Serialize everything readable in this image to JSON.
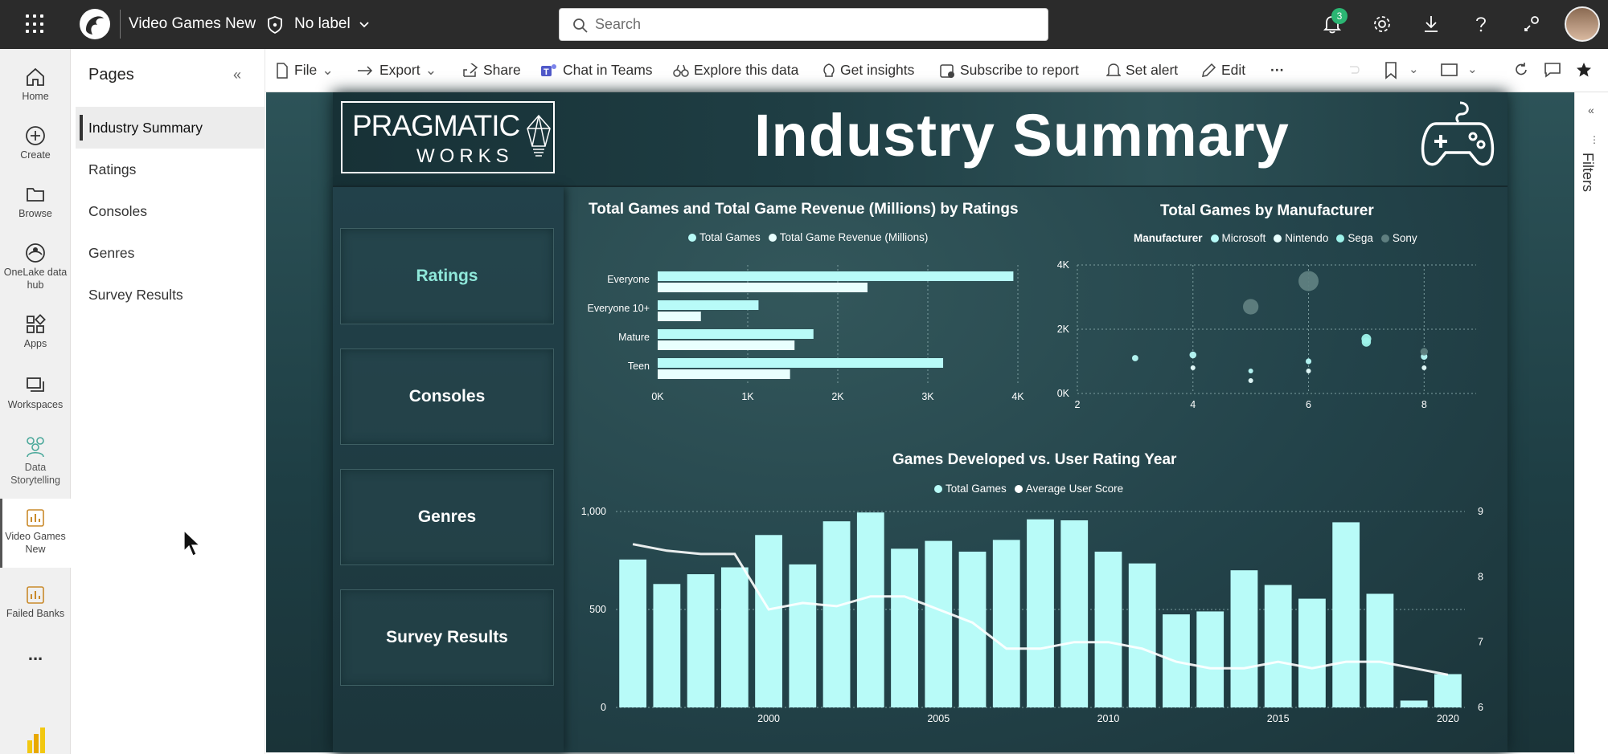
{
  "topbar": {
    "workspace_title": "Video Games New",
    "sensitivity_label": "No label",
    "search_placeholder": "Search",
    "notification_count": "3",
    "icons": [
      "app-launcher-icon",
      "notifications-icon",
      "settings-icon",
      "download-icon",
      "help-icon",
      "share-people-icon"
    ]
  },
  "leftnav": {
    "items": [
      {
        "label": "Home",
        "icon": "home-icon"
      },
      {
        "label": "Create",
        "icon": "plus-circle-icon"
      },
      {
        "label": "Browse",
        "icon": "folder-icon"
      },
      {
        "label": "OneLake data hub",
        "icon": "onelake-icon"
      },
      {
        "label": "Apps",
        "icon": "apps-icon"
      },
      {
        "label": "Workspaces",
        "icon": "workspaces-icon"
      },
      {
        "label": "Data Storytelling",
        "icon": "storytelling-icon"
      },
      {
        "label": "Video Games New",
        "icon": "report-icon"
      },
      {
        "label": "Failed Banks",
        "icon": "report-icon"
      },
      {
        "label": "...",
        "icon": "more-icon"
      }
    ]
  },
  "pages": {
    "title": "Pages",
    "items": [
      "Industry Summary",
      "Ratings",
      "Consoles",
      "Genres",
      "Survey Results"
    ],
    "selected": "Industry Summary"
  },
  "actionbar": {
    "file": "File",
    "export": "Export",
    "share": "Share",
    "chat_in_teams": "Chat in Teams",
    "explore": "Explore this data",
    "insights": "Get insights",
    "subscribe": "Subscribe to report",
    "set_alert": "Set alert",
    "edit": "Edit",
    "more": "···"
  },
  "report": {
    "logo_line1": "PRAGMATIC",
    "logo_line2": "WORKS",
    "title": "Industry Summary",
    "nav_buttons": [
      "Ratings",
      "Consoles",
      "Genres",
      "Survey Results"
    ],
    "colors": {
      "accent": "#b8fbf8",
      "sony": "#5f7f80",
      "active_nav": "#8fe8da"
    }
  },
  "filters_label": "Filters",
  "chart_data": [
    {
      "type": "bar",
      "orientation": "horizontal",
      "title": "Total Games and Total Game Revenue (Millions) by Ratings",
      "categories": [
        "Everyone",
        "Everyone 10+",
        "Mature",
        "Teen"
      ],
      "series": [
        {
          "name": "Total Games",
          "values": [
            3950,
            1120,
            1730,
            3170
          ]
        },
        {
          "name": "Total Game Revenue (Millions)",
          "values": [
            2330,
            480,
            1520,
            1470
          ]
        }
      ],
      "x_ticks": [
        "0K",
        "1K",
        "2K",
        "3K",
        "4K"
      ],
      "xlim": [
        0,
        4000
      ]
    },
    {
      "type": "scatter",
      "title": "Total Games by Manufacturer",
      "legend_title": "Manufacturer",
      "series": [
        {
          "name": "Microsoft",
          "points": [
            [
              3,
              1100
            ],
            [
              4,
              1200
            ],
            [
              5,
              700
            ],
            [
              6,
              1000
            ],
            [
              8,
              1150
            ]
          ]
        },
        {
          "name": "Nintendo",
          "points": [
            [
              4,
              800
            ],
            [
              5,
              400
            ],
            [
              6,
              700
            ],
            [
              8,
              800
            ]
          ]
        },
        {
          "name": "Sega",
          "points": [
            [
              7,
              1600
            ],
            [
              7,
              1700
            ]
          ]
        },
        {
          "name": "Sony",
          "points": [
            [
              5,
              2700
            ],
            [
              6,
              3500
            ],
            [
              8,
              1300
            ]
          ]
        }
      ],
      "x_ticks": [
        "2",
        "4",
        "6",
        "8"
      ],
      "y_ticks": [
        "0K",
        "2K",
        "4K"
      ],
      "xlim": [
        2,
        8.9
      ],
      "ylim": [
        0,
        4000
      ]
    },
    {
      "type": "bar",
      "title": "Games Developed vs. User Rating Year",
      "categories": [
        1996,
        1997,
        1998,
        1999,
        2000,
        2001,
        2002,
        2003,
        2004,
        2005,
        2006,
        2007,
        2008,
        2009,
        2010,
        2011,
        2012,
        2013,
        2014,
        2015,
        2016,
        2017,
        2018,
        2019,
        2020
      ],
      "series": [
        {
          "name": "Total Games",
          "values": [
            755,
            630,
            680,
            715,
            880,
            730,
            950,
            995,
            810,
            850,
            795,
            855,
            960,
            955,
            795,
            735,
            475,
            490,
            700,
            625,
            555,
            945,
            580,
            35,
            170
          ]
        },
        {
          "name": "Average User Score",
          "axis": "right",
          "values": [
            8.5,
            8.4,
            8.35,
            8.35,
            7.5,
            7.6,
            7.55,
            7.7,
            7.7,
            7.5,
            7.3,
            6.9,
            6.9,
            7.0,
            7.0,
            6.9,
            6.7,
            6.6,
            6.6,
            6.7,
            6.6,
            6.7,
            6.7,
            6.6,
            6.5
          ]
        }
      ],
      "x_ticks": [
        "2000",
        "2005",
        "2010",
        "2015",
        "2020"
      ],
      "y_ticks": [
        "0",
        "500",
        "1,000"
      ],
      "y2_ticks": [
        "6",
        "7",
        "8",
        "9"
      ],
      "ylim": [
        0,
        1000
      ],
      "y2lim": [
        6,
        9
      ]
    }
  ]
}
